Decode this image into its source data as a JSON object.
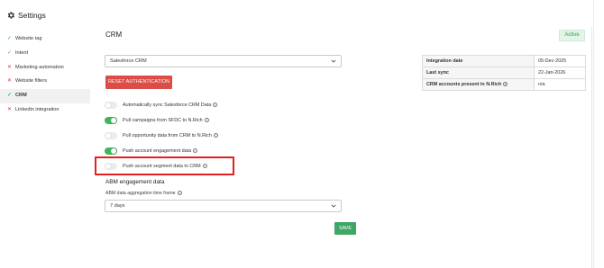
{
  "header": {
    "title": "Settings",
    "icon": "gear-icon"
  },
  "sidebar": {
    "items": [
      {
        "label": "Website tag",
        "status": "check"
      },
      {
        "label": "Intent",
        "status": "check"
      },
      {
        "label": "Marketing automation",
        "status": "cross"
      },
      {
        "label": "Website filters",
        "status": "cross"
      },
      {
        "label": "CRM",
        "status": "check",
        "active": true
      },
      {
        "label": "Linkedin integration",
        "status": "cross"
      }
    ]
  },
  "main": {
    "title": "CRM",
    "status_badge": "Active",
    "crm_select": {
      "value": "Salesforce CRM"
    },
    "reset_button": "RESET AUTHENTICATION",
    "toggles": [
      {
        "label": "Automatically sync Salesforce CRM Data",
        "on": false
      },
      {
        "label": "Pull campaigns from SFDC to N.Rich",
        "on": true
      },
      {
        "label": "Pull opportunity data from CRM to N.Rich",
        "on": false
      },
      {
        "label": "Push account engagement data",
        "on": true
      },
      {
        "label": "Push account segment data to CRM",
        "on": false
      }
    ],
    "abm": {
      "title": "ABM engagement data",
      "timeframe_label": "ABM data aggregation time frame",
      "timeframe_value": "7 days"
    },
    "save_button": "SAVE"
  },
  "info_table": {
    "rows": [
      {
        "key": "Integration date",
        "value": "05-Dec-2025"
      },
      {
        "key": "Last sync",
        "value": "22-Jan-2026"
      },
      {
        "key": "CRM accounts present in N.Rich",
        "value": "n/a"
      }
    ]
  },
  "colors": {
    "accent_green": "#3fb65c",
    "reset_red": "#db4d47",
    "highlight_red": "#e31f1f",
    "save_green": "#3fa665"
  }
}
